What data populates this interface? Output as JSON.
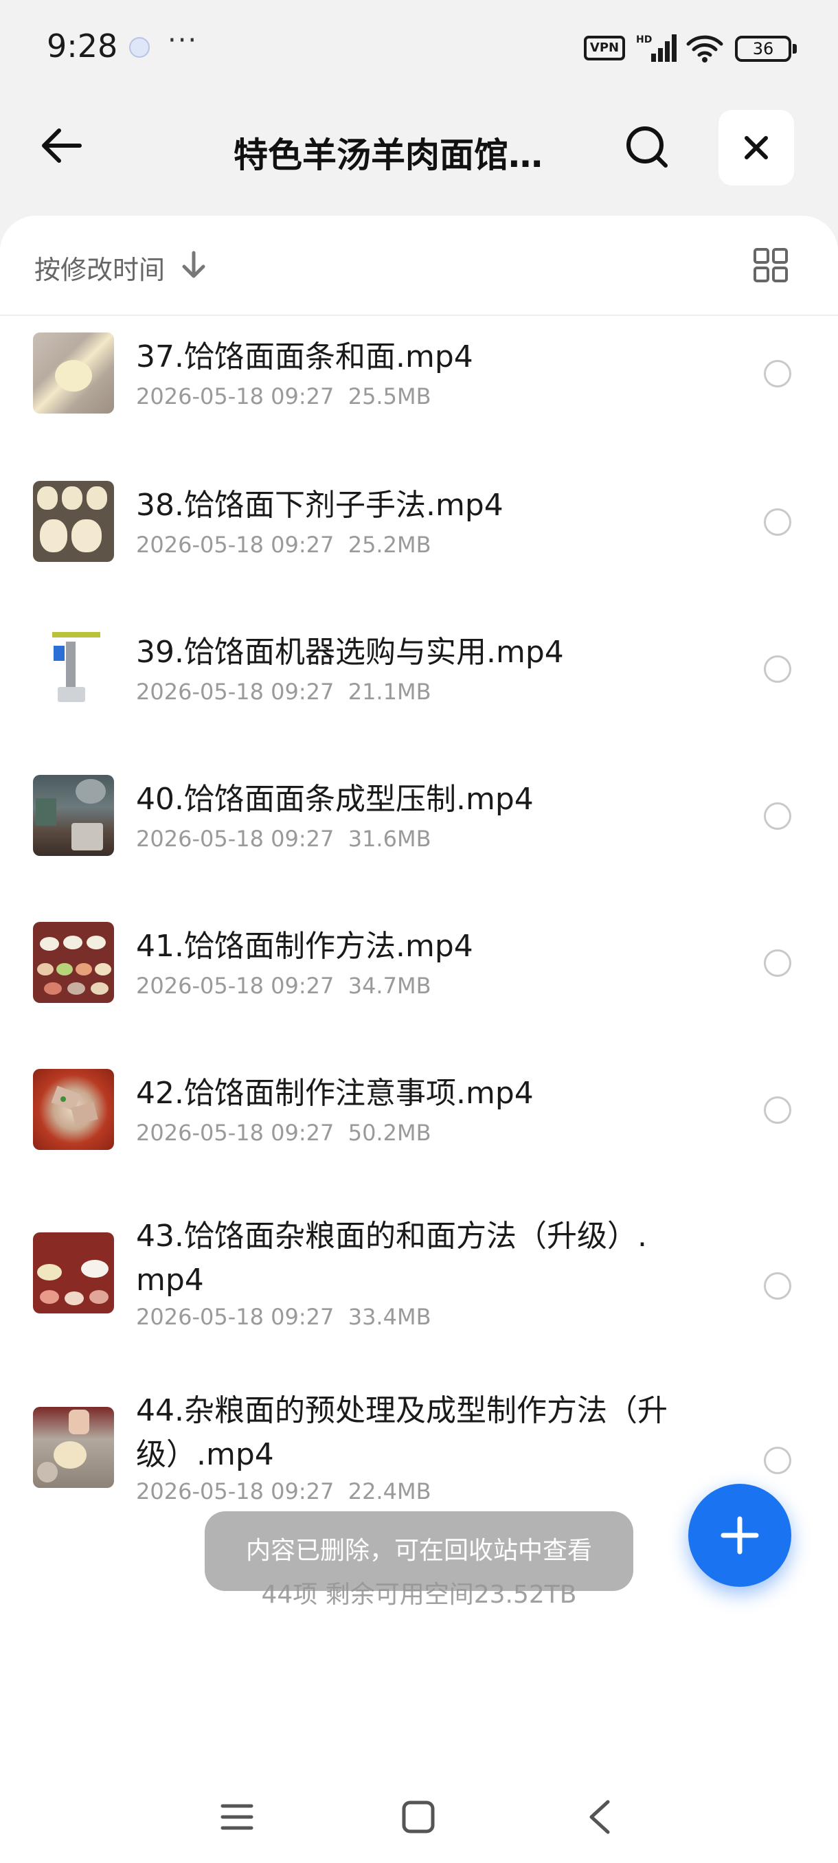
{
  "status_bar": {
    "time": "9:28",
    "dots": "···",
    "vpn": "VPN",
    "hd": "HD",
    "battery": "36"
  },
  "header": {
    "title": "特色羊汤羊肉面馆…"
  },
  "sort": {
    "label": "按修改时间"
  },
  "files": [
    {
      "name": "37.饸饹面面条和面.mp4",
      "date": "2026-05-18 09:27",
      "size": "25.5MB"
    },
    {
      "name": "38.饸饹面下剂子手法.mp4",
      "date": "2026-05-18 09:27",
      "size": "25.2MB"
    },
    {
      "name": "39.饸饹面机器选购与实用.mp4",
      "date": "2026-05-18 09:27",
      "size": "21.1MB"
    },
    {
      "name": "40.饸饹面面条成型压制.mp4",
      "date": "2026-05-18 09:27",
      "size": "31.6MB"
    },
    {
      "name": "41.饸饹面制作方法.mp4",
      "date": "2026-05-18 09:27",
      "size": "34.7MB"
    },
    {
      "name": "42.饸饹面制作注意事项.mp4",
      "date": "2026-05-18 09:27",
      "size": "50.2MB"
    },
    {
      "name": "43.饸饹面杂粮面的和面方法（升级）.mp4",
      "date": "2026-05-18 09:27",
      "size": "33.4MB"
    },
    {
      "name": "44.杂粮面的预处理及成型制作方法（升级）.mp4",
      "date": "2026-05-18 09:27",
      "size": "22.4MB"
    }
  ],
  "footer": {
    "summary": "44项 剩余可用空间23.52TB"
  },
  "toast": {
    "message": "内容已删除，可在回收站中查看"
  },
  "icons": {
    "back": "arrow-left-icon",
    "search": "search-icon",
    "close": "close-icon",
    "sort": "arrow-down-icon",
    "view": "grid-icon",
    "fab": "plus-icon"
  },
  "colors": {
    "accent": "#1a73f0",
    "background": "#f2f2f2",
    "meta_text": "#9a9a9a"
  }
}
